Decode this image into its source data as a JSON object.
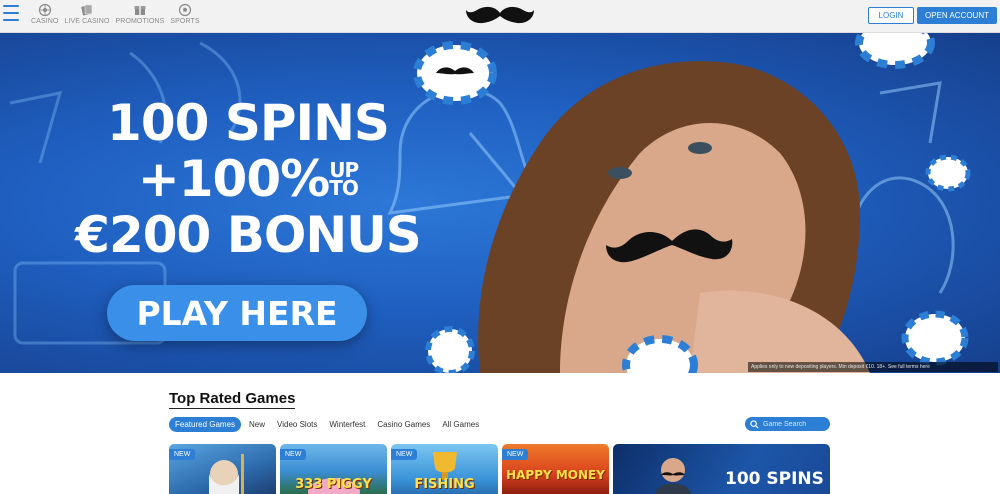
{
  "header": {
    "nav": [
      {
        "label": "CASINO",
        "icon": "roulette-icon"
      },
      {
        "label": "LIVE CASINO",
        "icon": "cards-icon"
      },
      {
        "label": "PROMOTIONS",
        "icon": "gift-icon"
      },
      {
        "label": "SPORTS",
        "icon": "football-icon"
      }
    ],
    "login_label": "LOGIN",
    "open_account_label": "OPEN ACCOUNT"
  },
  "hero": {
    "line1": "100 SPINS",
    "line2": "+100%",
    "line2_up": "UP",
    "line2_to": "TO",
    "line3": "€200 BONUS",
    "cta": "PLAY HERE",
    "disclaimer": "Applies only to new depositing players. Min deposit €10. 18+. See full terms here"
  },
  "games": {
    "title": "Top Rated Games",
    "tabs": [
      "Featured Games",
      "New",
      "Video Slots",
      "Winterfest",
      "Casino Games",
      "All Games"
    ],
    "search_placeholder": "Game Search",
    "cards": [
      {
        "badge": "NEW",
        "title": ""
      },
      {
        "badge": "NEW",
        "title": "333 PIGGY"
      },
      {
        "badge": "NEW",
        "title": "FISHING"
      },
      {
        "badge": "NEW",
        "title": "HAPPY MONEY"
      }
    ],
    "promo_card_text": "100 SPINS"
  },
  "colors": {
    "accent": "#2c7fd4",
    "hero_bg": "#1f5fc0",
    "header_bg": "#f2f2f2"
  }
}
